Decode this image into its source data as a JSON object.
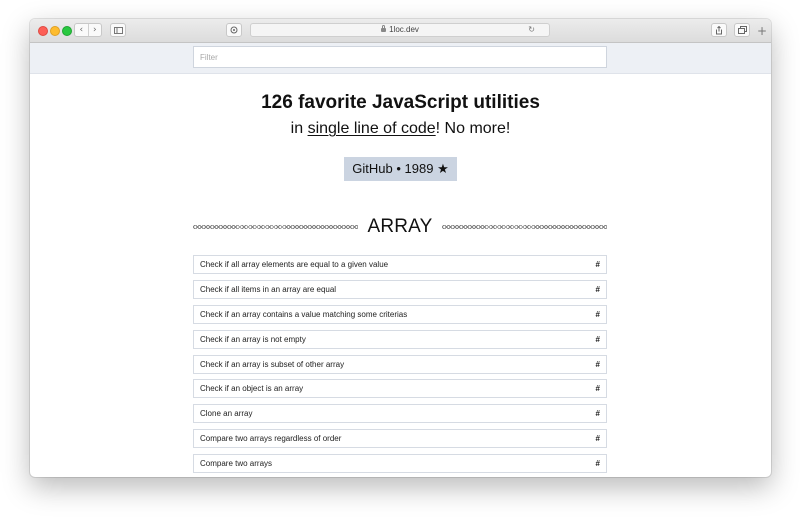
{
  "browser": {
    "address": "1loc.dev",
    "nav_back": "‹",
    "nav_forward": "›",
    "plus": "+"
  },
  "filter": {
    "placeholder": "Filter"
  },
  "header": {
    "title": "126 favorite JavaScript utilities",
    "subtitle_before": "in ",
    "subtitle_link": "single line of code",
    "subtitle_after": "! No more!",
    "github_label": "GitHub • 1989",
    "star": "★"
  },
  "section": {
    "title": "ARRAY",
    "items": [
      {
        "label": "Check if all array elements are equal to a given value",
        "anchor": "#"
      },
      {
        "label": "Check if all items in an array are equal",
        "anchor": "#"
      },
      {
        "label": "Check if an array contains a value matching some criterias",
        "anchor": "#"
      },
      {
        "label": "Check if an array is not empty",
        "anchor": "#"
      },
      {
        "label": "Check if an array is subset of other array",
        "anchor": "#"
      },
      {
        "label": "Check if an object is an array",
        "anchor": "#"
      },
      {
        "label": "Clone an array",
        "anchor": "#"
      },
      {
        "label": "Compare two arrays regardless of order",
        "anchor": "#"
      },
      {
        "label": "Compare two arrays",
        "anchor": "#"
      }
    ]
  }
}
